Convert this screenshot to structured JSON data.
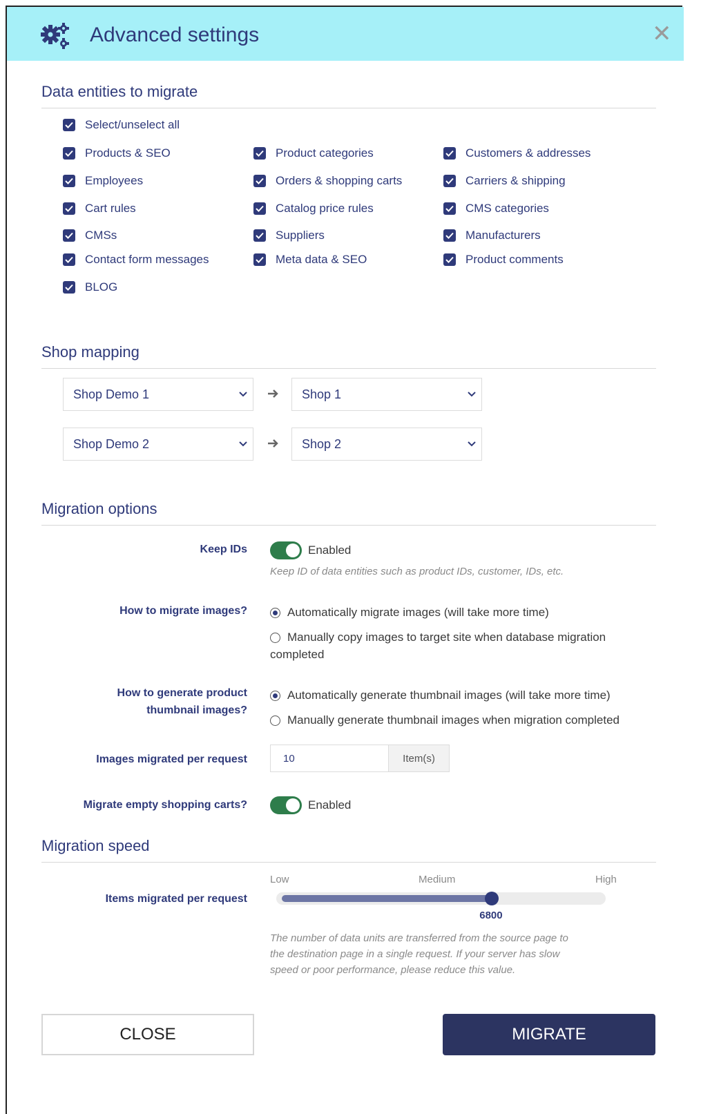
{
  "header": {
    "title": "Advanced settings",
    "close_icon": "close-icon",
    "settings_icon": "gears-icon"
  },
  "entities": {
    "title": "Data entities to migrate",
    "select_all": "Select/unselect all",
    "items": [
      "Products & SEO",
      "Product categories",
      "Customers & addresses",
      "Employees",
      "Orders & shopping carts",
      "Carriers & shipping",
      "Cart rules",
      "Catalog price rules",
      "CMS categories",
      "CMSs",
      "Suppliers",
      "Manufacturers",
      "Contact form messages",
      "Meta data & SEO",
      "Product comments",
      "BLOG"
    ]
  },
  "shop_mapping": {
    "title": "Shop mapping",
    "rows": [
      {
        "source": "Shop Demo 1",
        "target": "Shop 1"
      },
      {
        "source": "Shop Demo 2",
        "target": "Shop 2"
      }
    ]
  },
  "options": {
    "title": "Migration options",
    "keep_ids": {
      "label": "Keep IDs",
      "state": "Enabled",
      "hint": "Keep ID of data entities such as product IDs, customer, IDs, etc."
    },
    "images": {
      "label": "How to migrate images?",
      "option1": "Automatically migrate images (will take more time)",
      "option2_line1": "Manually copy images to target site when database migration",
      "option2_line2": "completed"
    },
    "thumbnails": {
      "label_line1": "How to generate product",
      "label_line2": "thumbnail images?",
      "option1": "Automatically generate thumbnail images (will take more time)",
      "option2": "Manually generate thumbnail images when migration completed"
    },
    "images_per_request": {
      "label": "Images migrated per request",
      "value": "10",
      "unit": "Item(s)"
    },
    "empty_carts": {
      "label": "Migrate empty shopping carts?",
      "state": "Enabled"
    }
  },
  "speed": {
    "title": "Migration speed",
    "label": "Items migrated per request",
    "low": "Low",
    "medium": "Medium",
    "high": "High",
    "value": "6800",
    "level": 0.66,
    "hint_line1": "The number of data units are transferred from the source page to",
    "hint_line2": "the destination page in a single request. If your server has slow",
    "hint_line3": "speed or poor performance, please reduce this value."
  },
  "buttons": {
    "close": "CLOSE",
    "migrate": "MIGRATE"
  },
  "colors": {
    "header_bg": "#a6f0f8",
    "accent": "#2f3a7a",
    "toggle_on": "#2e7d4b",
    "primary_button": "#2c3461"
  }
}
